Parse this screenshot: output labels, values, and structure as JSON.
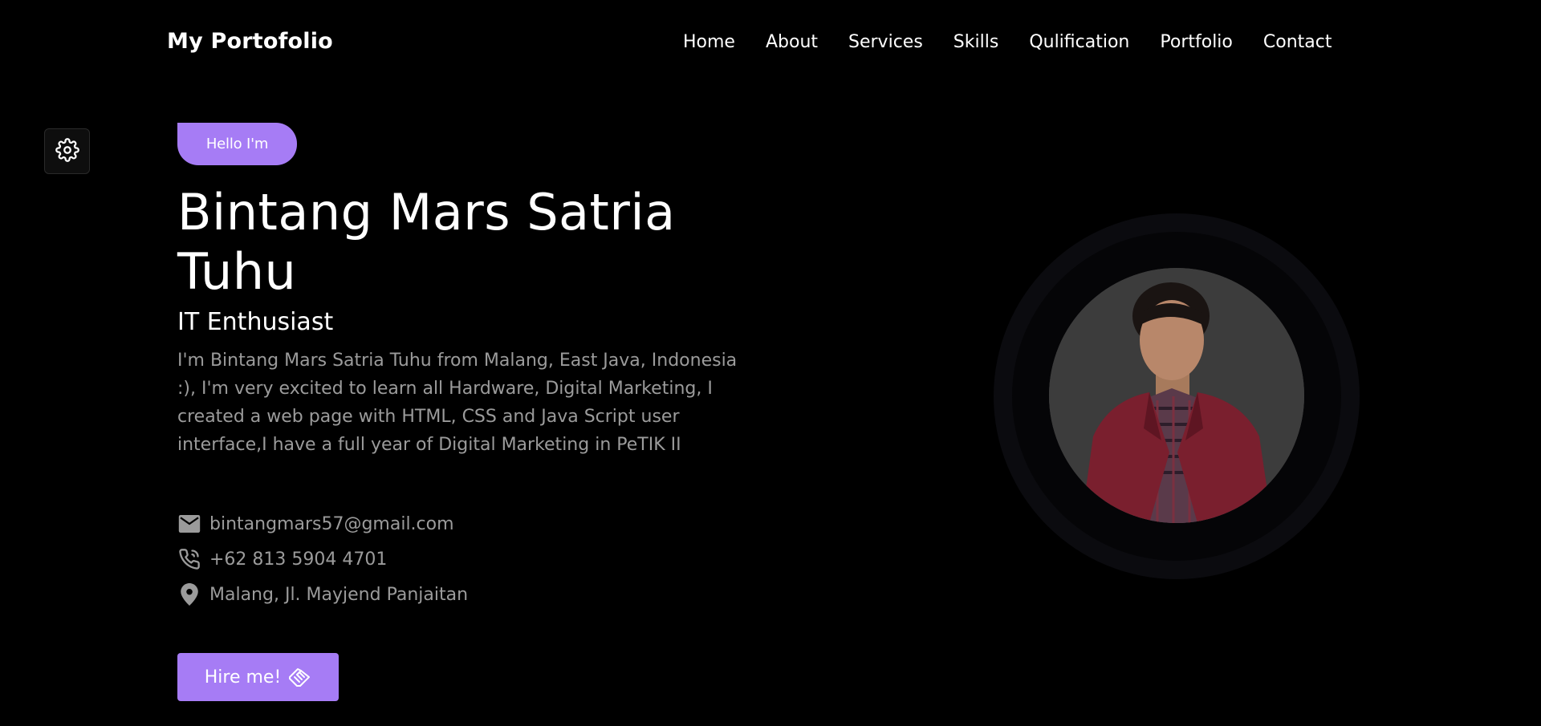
{
  "header": {
    "logo": "My Portofolio",
    "nav": [
      "Home",
      "About",
      "Services",
      "Skills",
      "Qulification",
      "Portfolio",
      "Contact"
    ]
  },
  "settings": {
    "icon": "gear-icon"
  },
  "hero": {
    "badge": "Hello I'm",
    "name": "Bintang Mars Satria Tuhu",
    "role": "IT Enthusiast",
    "bio": "I'm Bintang Mars Satria Tuhu from Malang, East Java, Indonesia :), I'm very excited to learn all Hardware, Digital Marketing, I created a web page with HTML, CSS and Java Script user interface,I have a full year of Digital Marketing in PeTIK II",
    "contacts": [
      {
        "icon": "mail-icon",
        "text": "bintangmars57@gmail.com"
      },
      {
        "icon": "phone-icon",
        "text": "+62 813 5904 4701"
      },
      {
        "icon": "location-icon",
        "text": "Malang, Jl. Mayjend Panjaitan"
      }
    ],
    "hire_label": "Hire me!",
    "hire_icon": "handshake-icon"
  },
  "colors": {
    "accent": "#a67cf5",
    "background": "#000000",
    "muted_text": "#9b9b9b"
  }
}
